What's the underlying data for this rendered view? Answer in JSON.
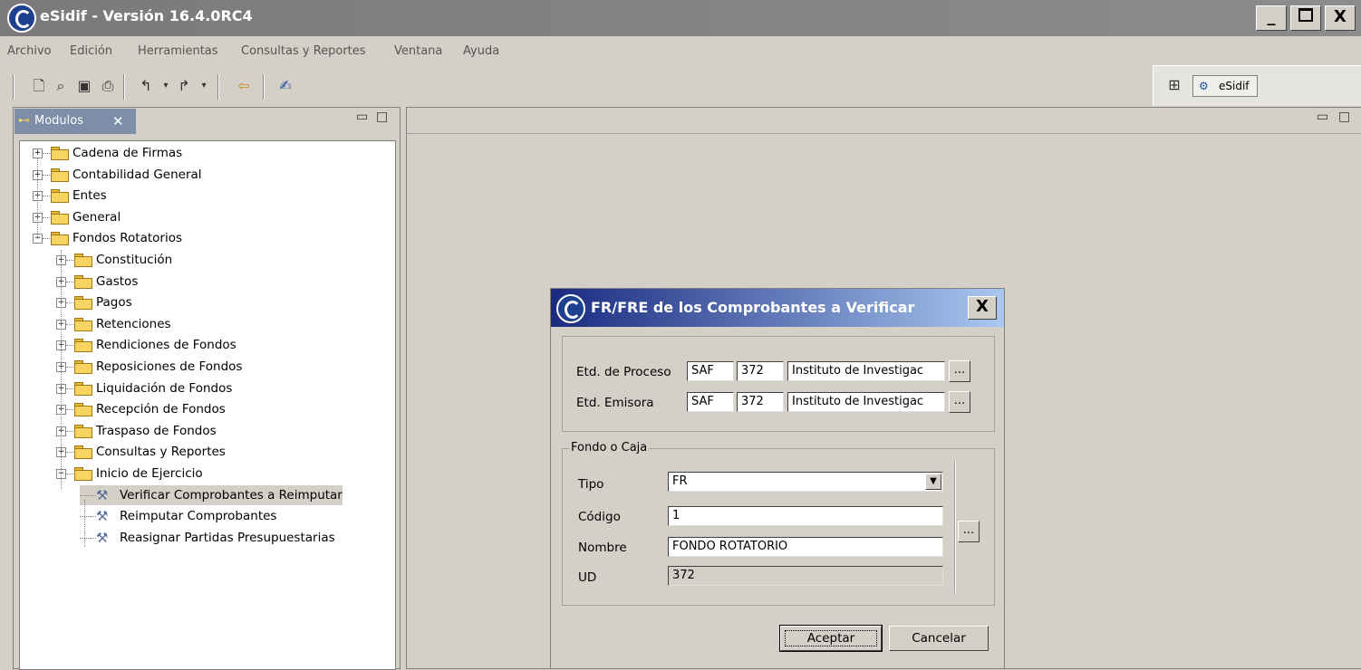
{
  "window": {
    "title": "eSidif - Versión 16.4.0RC4",
    "controls": {
      "minimize": "_",
      "restore": "▫",
      "close": "X"
    }
  },
  "menu": [
    "Archivo",
    "Edición",
    "Herramientas",
    "Consultas y Reportes",
    "Ventana",
    "Ayuda"
  ],
  "perspective": {
    "label": "eSidif"
  },
  "modulos_panel": {
    "tab_label": "Modulos",
    "tree": [
      {
        "label": "Cadena de Firmas",
        "level": 0,
        "expanded": false
      },
      {
        "label": "Contabilidad General",
        "level": 0,
        "expanded": false
      },
      {
        "label": "Entes",
        "level": 0,
        "expanded": false
      },
      {
        "label": "General",
        "level": 0,
        "expanded": false
      },
      {
        "label": "Fondos Rotatorios",
        "level": 0,
        "expanded": true
      },
      {
        "label": "Constitución",
        "level": 1,
        "expanded": false
      },
      {
        "label": "Gastos",
        "level": 1,
        "expanded": false
      },
      {
        "label": "Pagos",
        "level": 1,
        "expanded": false
      },
      {
        "label": "Retenciones",
        "level": 1,
        "expanded": false
      },
      {
        "label": "Rendiciones de Fondos",
        "level": 1,
        "expanded": false
      },
      {
        "label": "Reposiciones de Fondos",
        "level": 1,
        "expanded": false
      },
      {
        "label": "Liquidación de Fondos",
        "level": 1,
        "expanded": false
      },
      {
        "label": "Recepción de Fondos",
        "level": 1,
        "expanded": false
      },
      {
        "label": "Traspaso de Fondos",
        "level": 1,
        "expanded": false
      },
      {
        "label": "Consultas y Reportes",
        "level": 1,
        "expanded": false
      },
      {
        "label": "Inicio de Ejercicio",
        "level": 1,
        "expanded": true
      },
      {
        "label": "Verificar Comprobantes a Reimputar",
        "level": 2,
        "leaf": true,
        "selected": true
      },
      {
        "label": "Reimputar Comprobantes",
        "level": 2,
        "leaf": true
      },
      {
        "label": "Reasignar Partidas Presupuestarias",
        "level": 2,
        "leaf": true
      }
    ]
  },
  "dialog": {
    "title": "FR/FRE de los Comprobantes a Verificar",
    "close": "X",
    "etd_proceso": {
      "label": "Etd. de Proceso",
      "tipo": "SAF",
      "codigo": "372",
      "nombre": "Instituto de Investigac",
      "lookup": "..."
    },
    "etd_emisora": {
      "label": "Etd. Emisora",
      "tipo": "SAF",
      "codigo": "372",
      "nombre": "Instituto de Investigac",
      "lookup": "..."
    },
    "fondo": {
      "legend": "Fondo o Caja",
      "tipo_label": "Tipo",
      "tipo_value": "FR",
      "codigo_label": "Código",
      "codigo_value": "1",
      "nombre_label": "Nombre",
      "nombre_value": "FONDO ROTATORIO",
      "ud_label": "UD",
      "ud_value": "372",
      "lookup": "..."
    },
    "buttons": {
      "accept": "Aceptar",
      "cancel": "Cancelar"
    }
  }
}
